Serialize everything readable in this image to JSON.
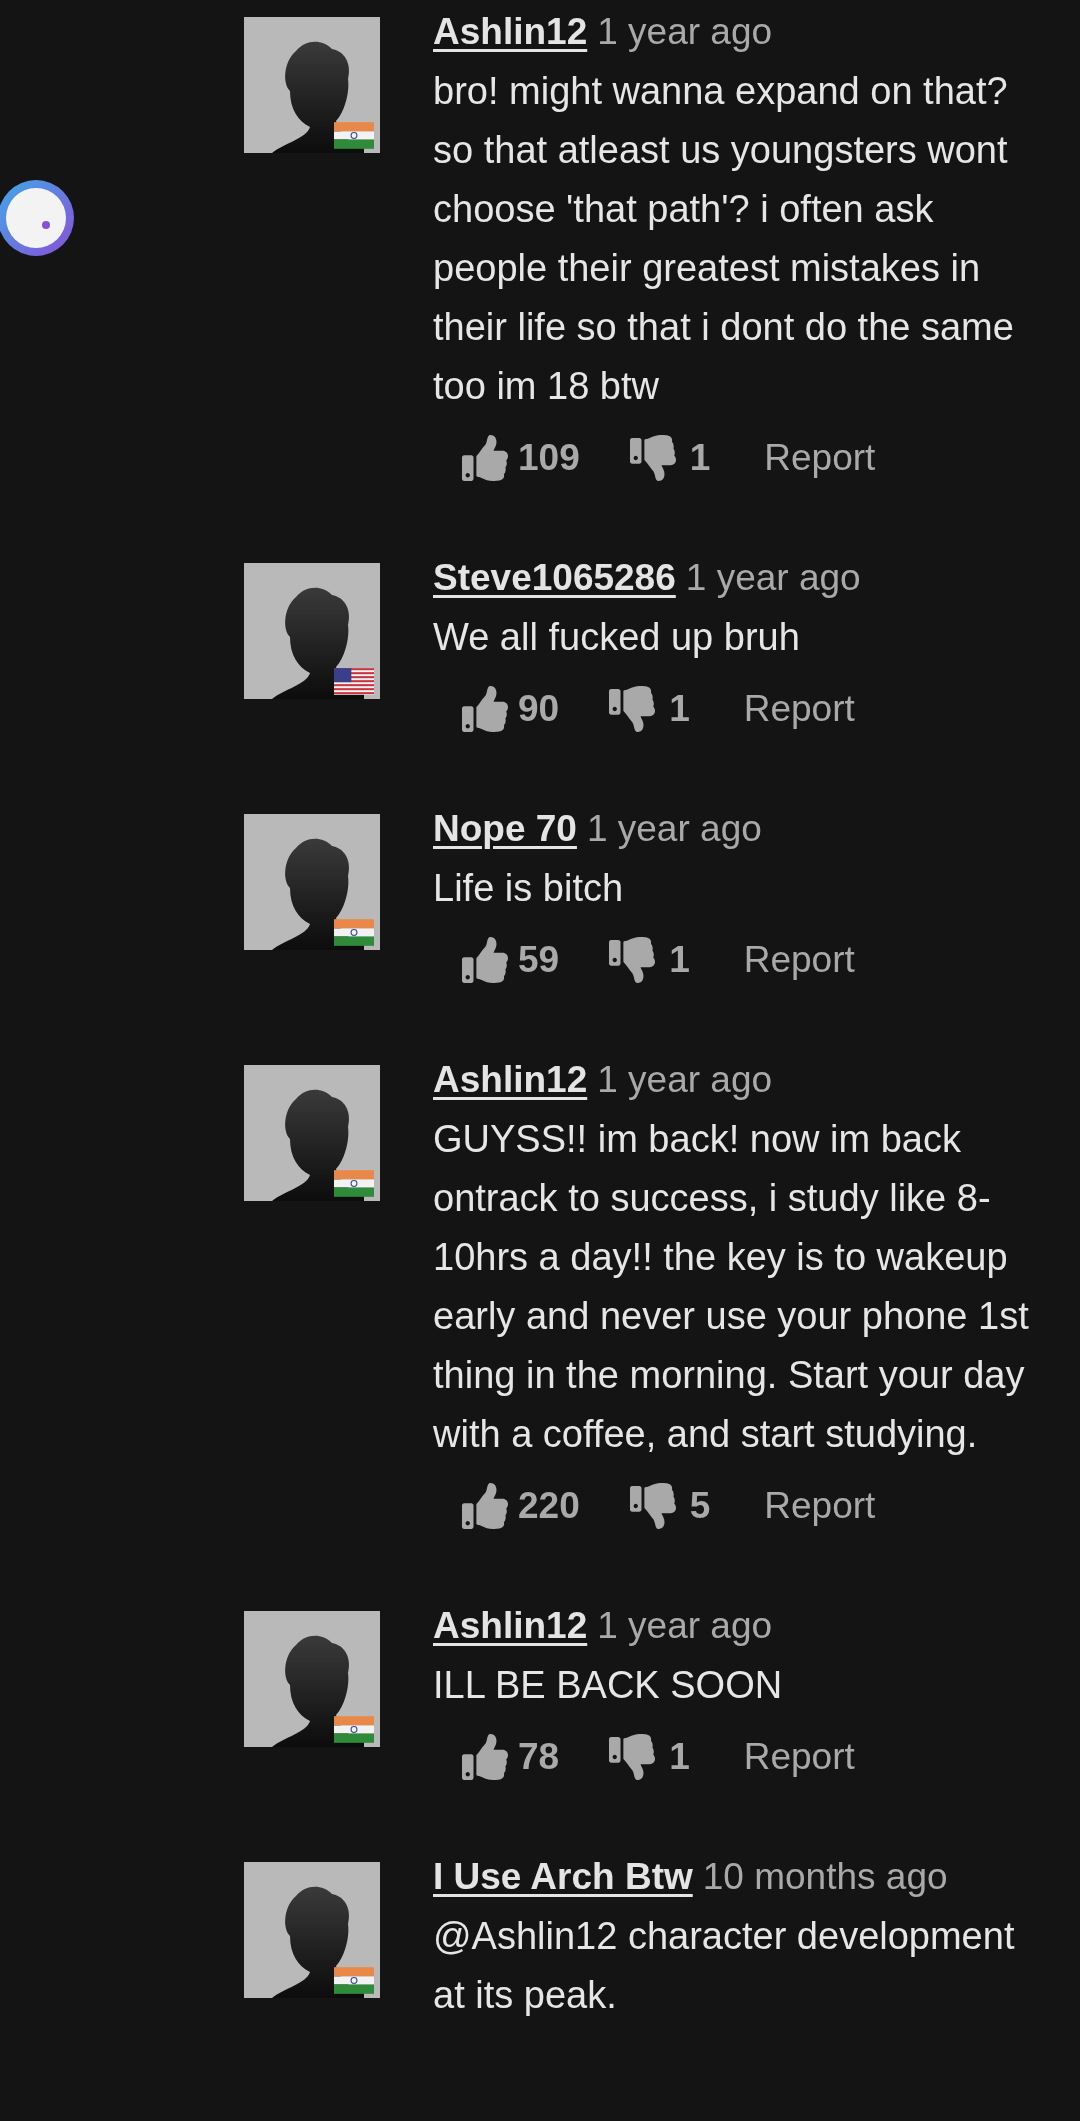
{
  "comments": [
    {
      "username": "Ashlin12",
      "time": "1 year ago",
      "flag": {
        "kind": "india"
      },
      "body": "bro! might wanna expand on that? so that atleast us youngsters wont choose 'that path'? i often ask people their greatest mistakes in their life so that i dont do the same too im 18 btw",
      "likes": "109",
      "dislikes": "1",
      "report": "Report"
    },
    {
      "username": "Steve1065286",
      "time": "1 year ago",
      "flag": {
        "kind": "usa"
      },
      "body": "We all fucked up bruh",
      "likes": "90",
      "dislikes": "1",
      "report": "Report"
    },
    {
      "username": "Nope 70",
      "time": "1 year ago",
      "flag": {
        "kind": "india"
      },
      "body": "Life is bitch",
      "likes": "59",
      "dislikes": "1",
      "report": "Report"
    },
    {
      "username": "Ashlin12",
      "time": "1 year ago",
      "flag": {
        "kind": "india"
      },
      "body": "GUYSS!! im back! now im back ontrack to success, i study like 8-10hrs a day!! the key is to wakeup early and never use your phone 1st thing in the morning. Start your day with a coffee, and start studying.",
      "likes": "220",
      "dislikes": "5",
      "report": "Report"
    },
    {
      "username": "Ashlin12",
      "time": "1 year ago",
      "flag": {
        "kind": "india"
      },
      "body": "ILL BE BACK SOON",
      "likes": "78",
      "dislikes": "1",
      "report": "Report"
    },
    {
      "username": "I Use Arch Btw",
      "time": "10 months ago",
      "flag": {
        "kind": "india"
      },
      "body": "@Ashlin12 character development at its peak."
    }
  ]
}
